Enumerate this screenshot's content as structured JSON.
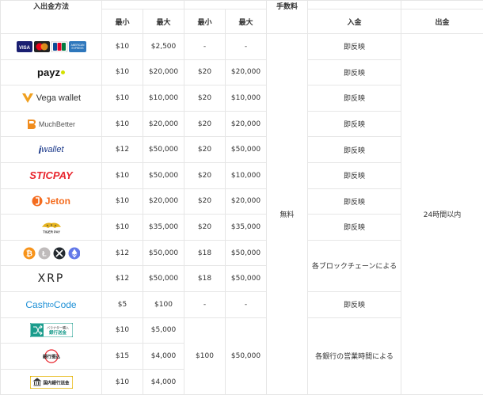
{
  "header": {
    "method": "入出金方法",
    "fee": "手数料",
    "deposit": "入金",
    "withdraw": "出金",
    "min": "最小",
    "max": "最大"
  },
  "rows": [
    {
      "logo_label": "VISA Mastercard JCB AMERICAN EXPRESS",
      "dep_min": "$10",
      "dep_max": "$2,500",
      "wd_min": "-",
      "wd_max": "-",
      "deposit_time": "即反映"
    },
    {
      "logo_label": "payz",
      "dep_min": "$10",
      "dep_max": "$20,000",
      "wd_min": "$20",
      "wd_max": "$20,000",
      "deposit_time": "即反映"
    },
    {
      "logo_label": "Vega wallet",
      "dep_min": "$10",
      "dep_max": "$10,000",
      "wd_min": "$20",
      "wd_max": "$10,000",
      "deposit_time": "即反映"
    },
    {
      "logo_label": "MuchBetter",
      "dep_min": "$10",
      "dep_max": "$20,000",
      "wd_min": "$20",
      "wd_max": "$20,000",
      "deposit_time": "即反映"
    },
    {
      "logo_label": "wallet",
      "dep_min": "$12",
      "dep_max": "$50,000",
      "wd_min": "$20",
      "wd_max": "$50,000",
      "deposit_time": "即反映"
    },
    {
      "logo_label": "STICPAY",
      "dep_min": "$10",
      "dep_max": "$50,000",
      "wd_min": "$20",
      "wd_max": "$10,000",
      "deposit_time": "即反映"
    },
    {
      "logo_label": "Jeton",
      "dep_min": "$10",
      "dep_max": "$20,000",
      "wd_min": "$20",
      "wd_max": "$20,000",
      "deposit_time": "即反映"
    },
    {
      "logo_label": "TIGER PAY",
      "dep_min": "$10",
      "dep_max": "$35,000",
      "wd_min": "$20",
      "wd_max": "$35,000",
      "deposit_time": "即反映"
    },
    {
      "logo_label": "crypto",
      "dep_min": "$12",
      "dep_max": "$50,000",
      "wd_min": "$18",
      "wd_max": "$50,000"
    },
    {
      "logo_label": "XRP",
      "dep_min": "$12",
      "dep_max": "$50,000",
      "wd_min": "$18",
      "wd_max": "$50,000"
    },
    {
      "logo_label": "CashtoCode",
      "dep_min": "$5",
      "dep_max": "$100",
      "wd_min": "-",
      "wd_max": "-",
      "deposit_time": "即反映"
    },
    {
      "logo_label": "バラナター購入 銀行送金",
      "dep_min": "$10",
      "dep_max": "$5,000"
    },
    {
      "logo_label": "銀行振込",
      "dep_min": "$15",
      "dep_max": "$4,000"
    },
    {
      "logo_label": "国内銀行送金",
      "dep_min": "$10",
      "dep_max": "$4,000"
    }
  ],
  "merged": {
    "fee": "無料",
    "withdraw_time": "24時間以内",
    "crypto_deposit_time": "各ブロックチェーンによる",
    "bank_deposit_time": "各銀行の営業時間による",
    "bank_wd_min": "$100",
    "bank_wd_max": "$50,000"
  },
  "logos": {
    "payz": "payz",
    "vega": "Vega wallet",
    "muchbetter": "MuchBetter",
    "iwallet": "wallet",
    "sticpay": "STICPAY",
    "jeton": "Jeton",
    "tigerpay": "TIGER PAY",
    "xrp": "XRP",
    "cashtocode_a": "Cash",
    "cashtocode_b": "to",
    "cashtocode_c": "Code",
    "bank1_a": "バラナター購入",
    "bank1_b": "銀行送金",
    "bank2": "銀行振込",
    "bank3": "国内銀行送金",
    "card_visa": "VISA",
    "card_jcb": "JCB",
    "card_amex": "AMERICAN EXPRESS"
  },
  "colors": {
    "border": "#e6e6e6",
    "visa_blue": "#1a1f71",
    "mc_red": "#eb001b",
    "mc_yellow": "#f79e1b",
    "payz_yellow": "#d4e000",
    "vega_orange": "#f0a020",
    "muchbetter_orange": "#f08c1e",
    "iwallet_blue": "#1e3c8c",
    "sticpay_red": "#e8262e",
    "jeton_orange": "#f46c1f",
    "tiger_gold": "#e6b420",
    "btc_orange": "#f7931a",
    "eth_blue": "#6278e8",
    "cashtocode_blue": "#1c8fd6",
    "bank_teal": "#1a9c8c",
    "bank_gold": "#e6b400"
  }
}
